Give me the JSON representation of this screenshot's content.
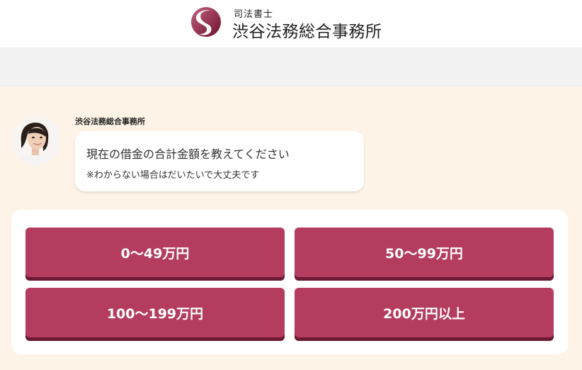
{
  "header": {
    "brand_sub": "司法書士",
    "brand_name": "渋谷法務総合事務所",
    "logo_icon": "s-mark-icon"
  },
  "chat": {
    "sender": "渋谷法務総合事務所",
    "question": "現在の借金の合計金額を教えてください",
    "note": "※わからない場合はだいたいで大丈夫です"
  },
  "options": [
    "0～49万円",
    "50～99万円",
    "100～199万円",
    "200万円以上"
  ],
  "colors": {
    "accent": "#b43c5f",
    "accent_dark": "#6b1a33",
    "background": "#fdf3e6",
    "band": "#f2f2f2"
  }
}
